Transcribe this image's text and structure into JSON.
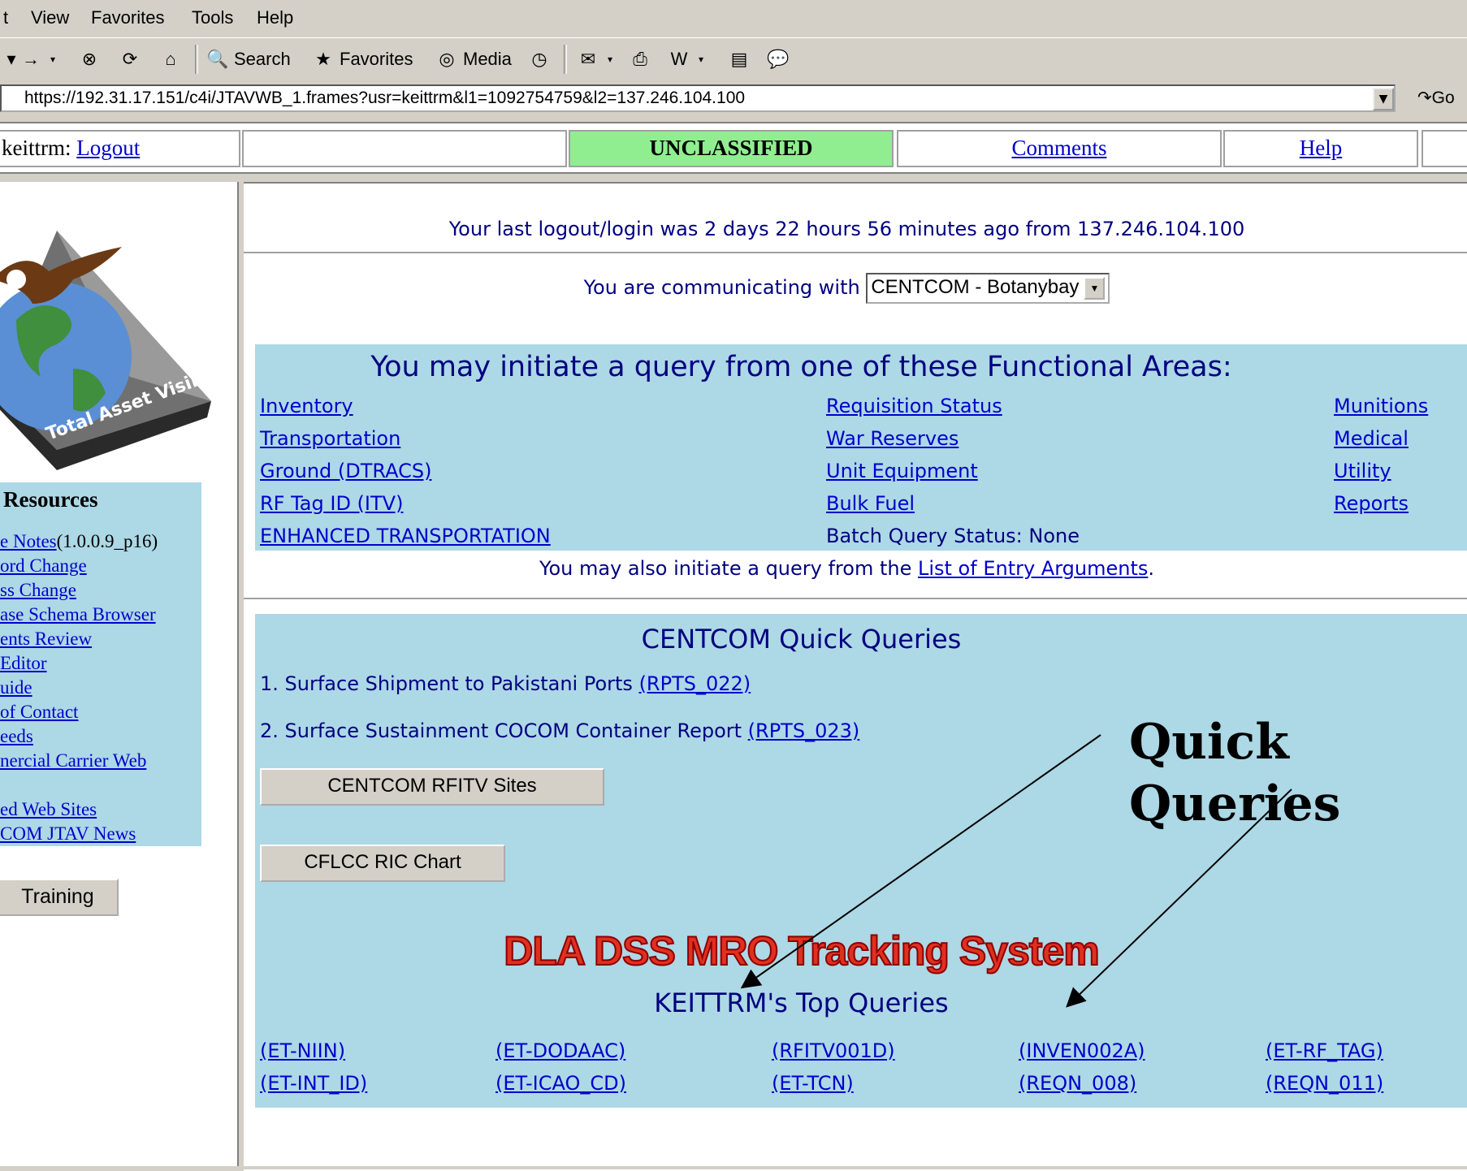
{
  "menubar": {
    "items": [
      "t",
      "View",
      "Favorites",
      "Tools",
      "Help"
    ]
  },
  "toolbar": {
    "back_label": "",
    "forward_label": "",
    "search_label": "Search",
    "favorites_label": "Favorites",
    "media_label": "Media"
  },
  "address": {
    "url": "https://192.31.17.151/c4i/JTAVWB_1.frames?usr=keittrm&l1=1092754759&l2=137.246.104.100",
    "go_label": "Go"
  },
  "topbar": {
    "user": "keittrm:",
    "logout": "Logout",
    "classification": "UNCLASSIFIED",
    "comments": "Comments",
    "help": "Help"
  },
  "sidebar": {
    "logo_text": "Total Asset Visibility",
    "resources_title": "Resources",
    "items": [
      {
        "link": "e Notes",
        "suffix": "(1.0.0.9_p16)"
      },
      {
        "link": "ord Change",
        "suffix": ""
      },
      {
        "link": "ss Change",
        "suffix": ""
      },
      {
        "link": "ase Schema Browser",
        "suffix": ""
      },
      {
        "link": "ents Review",
        "suffix": ""
      },
      {
        "link": " Editor",
        "suffix": ""
      },
      {
        "link": "uide",
        "suffix": ""
      },
      {
        "link": " of Contact",
        "suffix": ""
      },
      {
        "link": "eeds",
        "suffix": ""
      },
      {
        "link": "nercial Carrier Web",
        "suffix": ""
      },
      {
        "link": "ed Web Sites",
        "suffix": ""
      },
      {
        "link": "COM JTAV News",
        "suffix": ""
      }
    ],
    "training": "Training"
  },
  "main": {
    "last_login": "Your last logout/login was 2 days 22 hours 56 minutes ago from 137.246.104.100",
    "communicating_label": "You are communicating with",
    "communicating_value": "CENTCOM - Botanybay",
    "functional_heading": "You may initiate a query from one of these Functional Areas:",
    "functional_col1": [
      "Inventory",
      "Transportation",
      "Ground (DTRACS)",
      "RF Tag ID (ITV)",
      "ENHANCED TRANSPORTATION"
    ],
    "functional_col2": [
      "Requisition Status",
      "War Reserves",
      "Unit Equipment",
      "Bulk Fuel"
    ],
    "batch_status": "Batch Query Status: None",
    "functional_col3": [
      "Munitions",
      "Medical",
      "Utility",
      "Reports"
    ],
    "also_prefix": "You may also initiate a query from the ",
    "also_link": "List of Entry Arguments",
    "also_suffix": ".",
    "quick_heading": "CENTCOM Quick Queries",
    "quick_queries": [
      {
        "text": "1. Surface Shipment to Pakistani Ports ",
        "link": "(RPTS_022)"
      },
      {
        "text": "2. Surface Sustainment COCOM Container Report ",
        "link": "(RPTS_023)"
      }
    ],
    "rfitv_button": "CENTCOM RFITV Sites",
    "ric_button": "CFLCC RIC Chart",
    "dla_banner": "DLA DSS MRO Tracking System",
    "top_heading": "KEITTRM's Top Queries",
    "top_row1": [
      "(ET-NIIN)",
      "(ET-DODAAC)",
      "(RFITV001D)",
      "(INVEN002A)",
      "(ET-RF_TAG)"
    ],
    "top_row2": [
      "(ET-INT_ID)",
      "(ET-ICAO_CD)",
      "(ET-TCN)",
      "(REQN_008)",
      "(REQN_011)"
    ]
  },
  "callout": {
    "line1": "Quick",
    "line2": "Queries"
  }
}
